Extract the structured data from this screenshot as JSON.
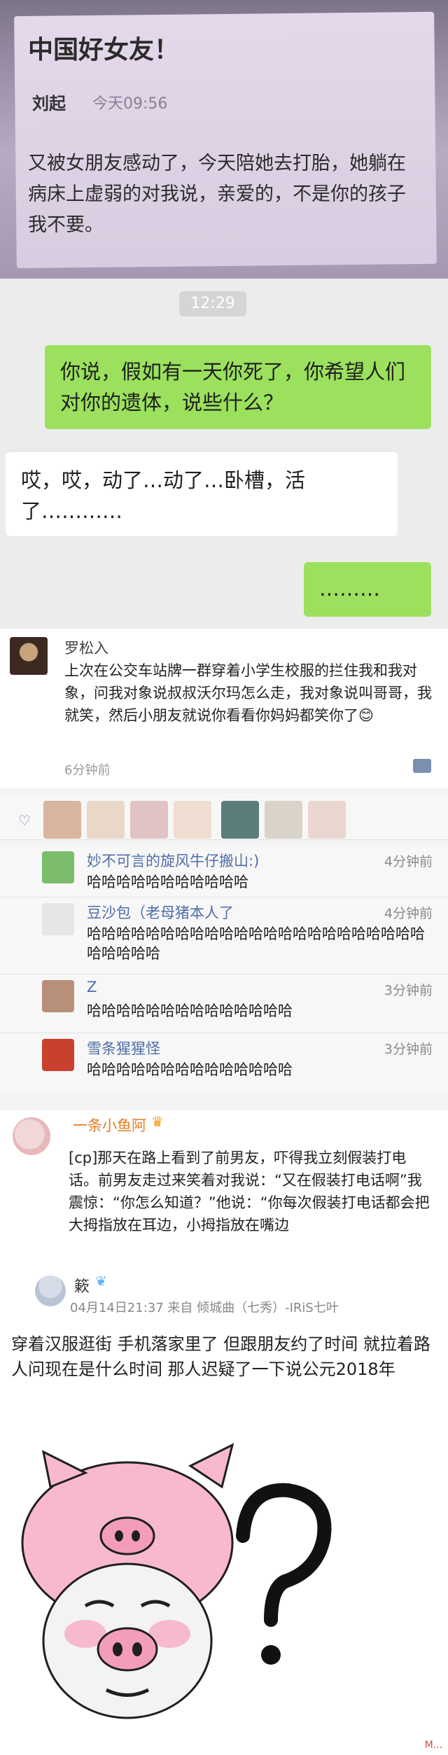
{
  "note": {
    "title": "中国好女友！",
    "author": "刘起",
    "time": "今天09:56",
    "body": "又被女朋友感动了，今天陪她去打胎，她躺在病床上虚弱的对我说，亲爱的，不是你的孩子我不要。"
  },
  "chat": {
    "time": "12:29",
    "messages": [
      {
        "side": "right",
        "text": "你说，假如有一天你死了，你希望人们对你的遗体，说些什么？"
      },
      {
        "side": "left",
        "text": "哎，哎，动了…动了…卧槽，活了…………"
      },
      {
        "side": "right",
        "text": "………"
      }
    ]
  },
  "comment": {
    "name": "罗松入",
    "text": "上次在公交车站牌一群穿着小学生校服的拦住我和我对象，问我对象说叔叔沃尔玛怎么走，我对象说叫哥哥，我就笑，然后小朋友就说你看看你妈妈都笑你了😊",
    "ago": "6分钟前"
  },
  "replies": [
    {
      "name": "妙不可言的旋风牛仔搬山:)",
      "text": "哈哈哈哈哈哈哈哈哈哈哈",
      "time": "4分钟前"
    },
    {
      "name": "豆沙包（老母猪本人了",
      "text": "哈哈哈哈哈哈哈哈哈哈哈哈哈哈哈哈哈哈哈哈哈哈哈哈哈哈哈哈",
      "time": "4分钟前"
    },
    {
      "name": "Z",
      "text": "哈哈哈哈哈哈哈哈哈哈哈哈哈哈",
      "time": "3分钟前"
    },
    {
      "name": "雪条猩猩怪",
      "text": "哈哈哈哈哈哈哈哈哈哈哈哈哈哈",
      "time": "3分钟前"
    }
  ],
  "qq": {
    "name": "一条小鱼阿",
    "text": "[cp]那天在路上看到了前男友，吓得我立刻假装打电话。前男友走过来笑着对我说：“又在假装打电话啊”我震惊：“你怎么知道？”他说：“你每次假装打电话都会把大拇指放在耳边，小拇指放在嘴边"
  },
  "post": {
    "name": "簌",
    "meta": "04月14日21:37  来自 倾城曲（七秀）-IRiS七叶",
    "text": "穿着汉服逛街 手机落家里了 但跟朋友约了时间 就拉着路人问现在是什么时间 那人迟疑了一下说公元2018年"
  },
  "watermark": "M...",
  "colors": {
    "bubble_green": "#9be15d",
    "link_blue": "#4e6ea8",
    "name_orange": "#e67e22"
  }
}
